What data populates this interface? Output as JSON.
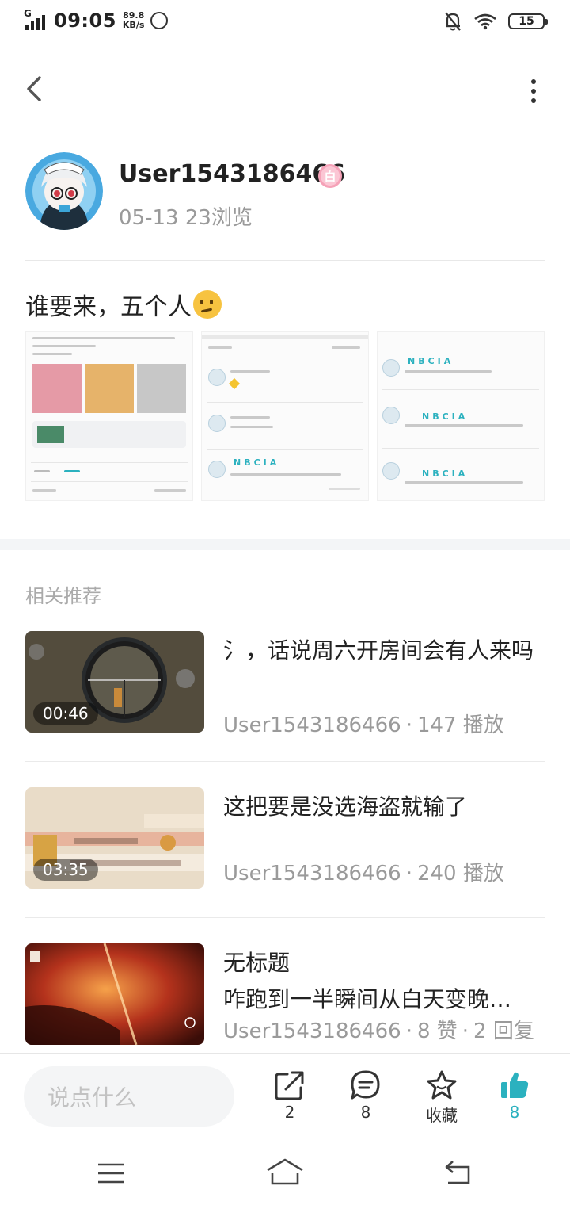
{
  "status_bar": {
    "network": "G",
    "time": "09:05",
    "speed_value": "89.8",
    "speed_unit": "KB/s",
    "battery": "15"
  },
  "author": {
    "username": "User1543186466",
    "level_badge": "白",
    "date": "05-13",
    "views": "23浏览"
  },
  "post": {
    "title": "谁要来，五个人",
    "emoji": "thinking-face-emoji"
  },
  "related": {
    "label": "相关推荐",
    "items": [
      {
        "title": "氵，话说周六开房间会有人来吗",
        "duration": "00:46",
        "author": "User1543186466",
        "stat": "147 播放"
      },
      {
        "title": "这把要是没选海盗就输了",
        "duration": "03:35",
        "author": "User1543186466",
        "stat": "240 播放"
      },
      {
        "title_line1": "无标题",
        "title_line2": "咋跑到一半瞬间从白天变晚…",
        "author": "User1543186466",
        "stat": "8 赞",
        "stat2": "2 回复"
      }
    ]
  },
  "actions": {
    "comment_placeholder": "说点什么",
    "share_count": "2",
    "comment_count": "8",
    "favorite_label": "收藏",
    "like_count": "8"
  },
  "colors": {
    "accent": "#2bb1bf",
    "muted": "#9a9a9a",
    "badge_pink": "#f5a2b8"
  }
}
